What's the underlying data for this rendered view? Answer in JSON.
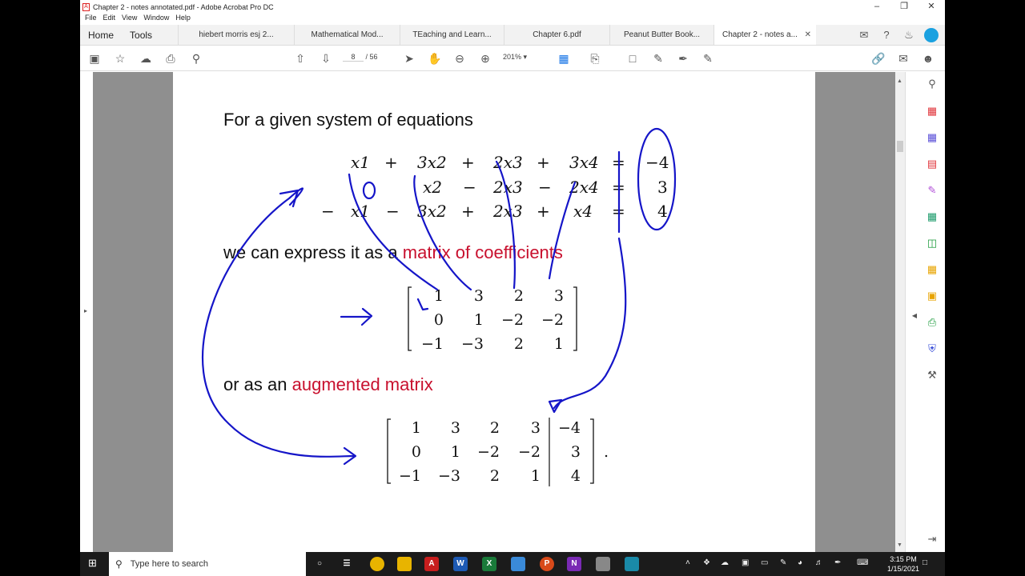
{
  "window": {
    "title": "Chapter 2 - notes annotated.pdf - Adobe Acrobat Pro DC",
    "menu": [
      "File",
      "Edit",
      "View",
      "Window",
      "Help"
    ]
  },
  "tabs": {
    "home": "Home",
    "tools": "Tools",
    "documents": [
      "hiebert morris esj 2...",
      "Mathematical Mod...",
      "TEaching and Learn...",
      "Chapter 6.pdf",
      "Peanut Butter Book...",
      "Chapter 2 - notes a..."
    ],
    "active_index": 5
  },
  "toolbar": {
    "page_current": "8",
    "page_total": "/ 56",
    "zoom": "201%"
  },
  "document": {
    "intro": "For a given system of equations",
    "express_prefix": "we can express it as a ",
    "express_highlight": "matrix of coefficients",
    "augmented_prefix": "or as an ",
    "augmented_highlight": "augmented matrix",
    "equations": {
      "row1": [
        "x1",
        "+",
        "3x2",
        "+",
        "2x3",
        "+",
        "3x4",
        "=",
        "−4"
      ],
      "row2": [
        "x2",
        "−",
        "2x3",
        "−",
        "2x4",
        "=",
        "3"
      ],
      "row3": [
        "−",
        "x1",
        "−",
        "3x2",
        "+",
        "2x3",
        "+",
        "x4",
        "=",
        "4"
      ]
    },
    "coefficient_matrix": [
      [
        "1",
        "3",
        "2",
        "3"
      ],
      [
        "0",
        "1",
        "−2",
        "−2"
      ],
      [
        "−1",
        "−3",
        "2",
        "1"
      ]
    ],
    "augmented_matrix": [
      [
        "1",
        "3",
        "2",
        "3",
        "−4"
      ],
      [
        "0",
        "1",
        "−2",
        "−2",
        "3"
      ],
      [
        "−1",
        "−3",
        "2",
        "1",
        "4"
      ]
    ],
    "annotation_zero": "0",
    "period": "."
  },
  "taskbar": {
    "search_placeholder": "Type here to search",
    "time": "3:15 PM",
    "date": "1/15/2021"
  },
  "colors": {
    "highlight": "#c8102e",
    "ink": "#1515c8",
    "acrobat_red": "#dd2222"
  }
}
